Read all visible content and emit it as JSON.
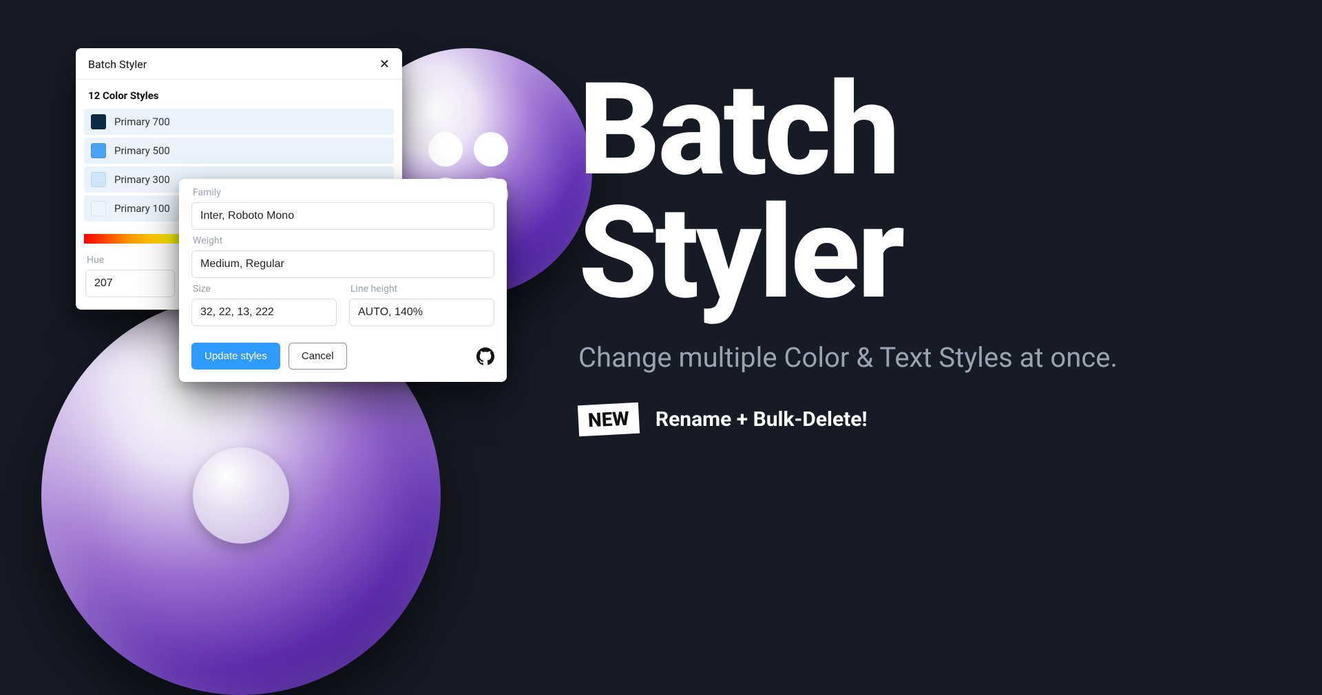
{
  "panel": {
    "title": "Batch Styler",
    "section_title": "12 Color Styles",
    "styles": [
      {
        "label": "Primary 700",
        "color": "#0f2a43"
      },
      {
        "label": "Primary 500",
        "color": "#4aa3ef"
      },
      {
        "label": "Primary 300",
        "color": "#cfe6f8"
      },
      {
        "label": "Primary 100",
        "color": "#edf6fd"
      }
    ],
    "hue_label": "Hue",
    "hue_value": "207"
  },
  "text_panel": {
    "family_label": "Family",
    "family_value": "Inter, Roboto Mono",
    "weight_label": "Weight",
    "weight_value": "Medium, Regular",
    "size_label": "Size",
    "size_value": "32, 22, 13, 222",
    "lineheight_label": "Line height",
    "lineheight_value": "AUTO, 140%",
    "update_label": "Update styles",
    "cancel_label": "Cancel"
  },
  "hero": {
    "title_line1": "Batch",
    "title_line2": "Styler",
    "tagline": "Change multiple Color & Text Styles at once.",
    "new_badge": "NEW",
    "new_text": "Rename + Bulk-Delete!"
  }
}
